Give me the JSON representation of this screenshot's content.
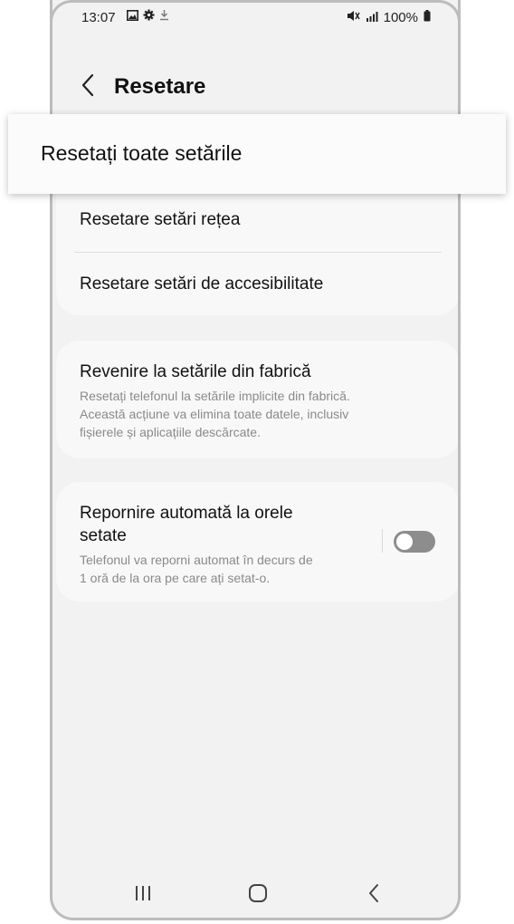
{
  "status_bar": {
    "time": "13:07",
    "battery": "100%",
    "left_icons": [
      "gallery-icon",
      "gear-icon",
      "download-icon"
    ],
    "right_icons": [
      "mute-icon",
      "signal-icon",
      "battery-icon"
    ]
  },
  "header": {
    "title": "Resetare"
  },
  "highlight": {
    "label": "Resetați toate setările"
  },
  "reset_group": {
    "items": [
      {
        "label": "Resetare setări rețea"
      },
      {
        "label": "Resetare setări de accesibilitate"
      }
    ]
  },
  "factory_reset": {
    "title": "Revenire la setările din fabrică",
    "description_lines": [
      "Resetați telefonul la setările implicite din fabrică.",
      "Această acțiune va elimina toate datele, inclusiv",
      "fișierele și aplicațiile descărcate."
    ]
  },
  "auto_restart": {
    "title_lines": [
      "Repornire automată la orele",
      "setate"
    ],
    "description_lines": [
      "Telefonul va reporni automat în decurs de",
      "1 oră de la ora pe care ați setat-o."
    ],
    "toggle_on": false
  },
  "nav_bar": {
    "buttons": [
      "recents-icon",
      "home-icon",
      "back-icon"
    ]
  },
  "colors": {
    "screen_bg": "#f2f2f2",
    "card_bg": "#f8f8f8",
    "toggle_off": "#8d8d8d",
    "secondary_text": "#8a8a8a"
  }
}
